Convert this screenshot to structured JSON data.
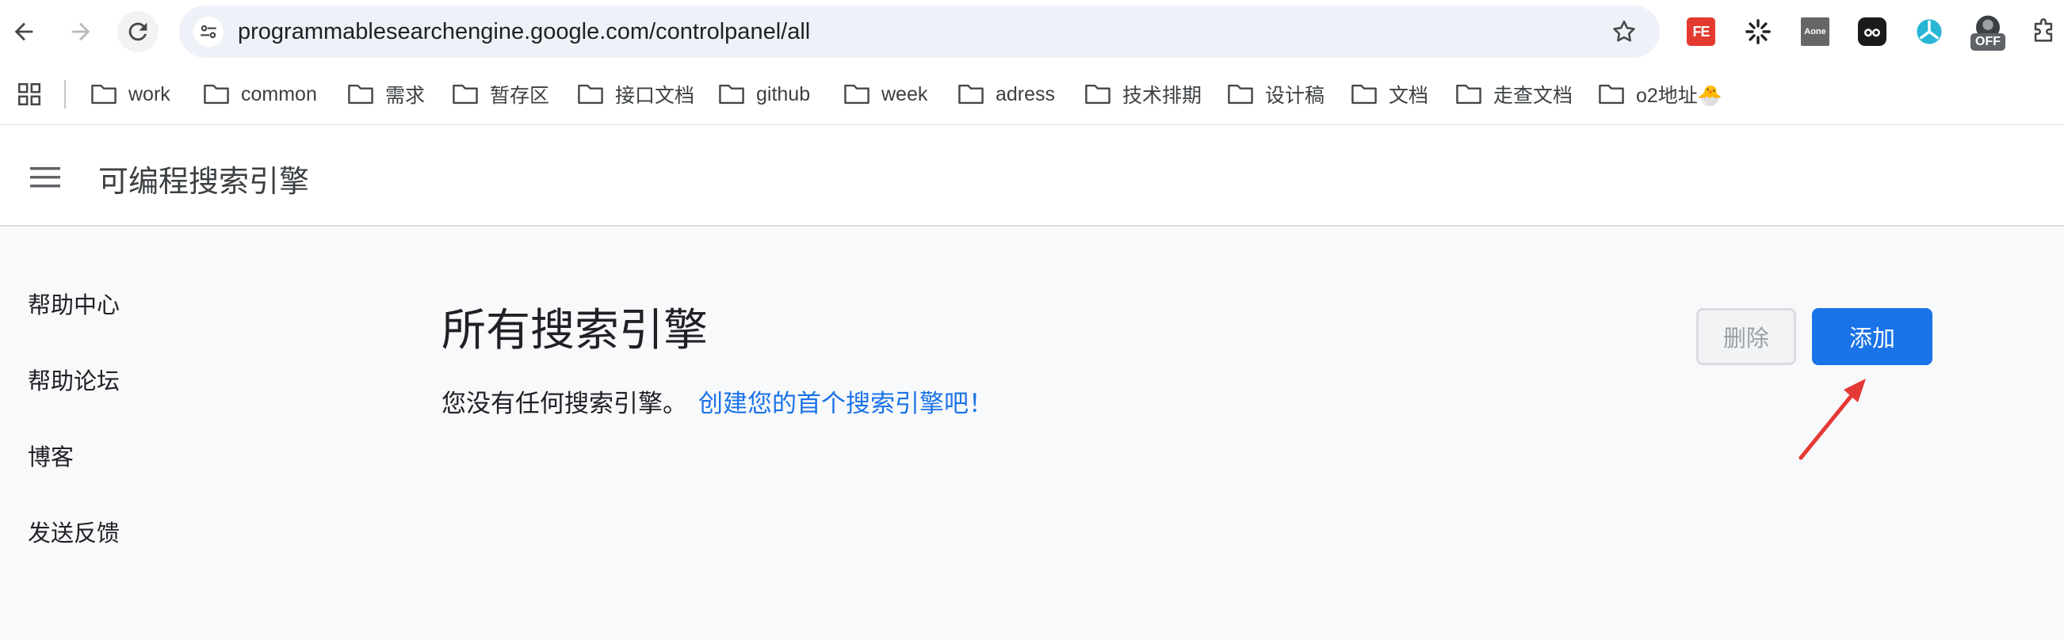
{
  "browser": {
    "url": "programmablesearchengine.google.com/controlpanel/all",
    "extensions": {
      "fe_label": "FE",
      "aone_label": "Aone",
      "off_badge": "OFF"
    }
  },
  "bookmarks": [
    {
      "label": "work"
    },
    {
      "label": "common"
    },
    {
      "label": "需求"
    },
    {
      "label": "暂存区"
    },
    {
      "label": "接口文档"
    },
    {
      "label": "github"
    },
    {
      "label": "week"
    },
    {
      "label": "adress"
    },
    {
      "label": "技术排期"
    },
    {
      "label": "设计稿"
    },
    {
      "label": "文档"
    },
    {
      "label": "走查文档"
    },
    {
      "label": "o2地址🐣"
    }
  ],
  "app": {
    "title": "可编程搜索引擎"
  },
  "sidebar": {
    "items": [
      {
        "label": "帮助中心"
      },
      {
        "label": "帮助论坛"
      },
      {
        "label": "博客"
      },
      {
        "label": "发送反馈"
      }
    ]
  },
  "main": {
    "title": "所有搜索引擎",
    "empty_message": "您没有任何搜索引擎。",
    "create_link": "创建您的首个搜索引擎吧！",
    "delete_label": "删除",
    "add_label": "添加"
  },
  "colors": {
    "accent": "#1a73e8",
    "annotation_arrow": "#e53935"
  }
}
